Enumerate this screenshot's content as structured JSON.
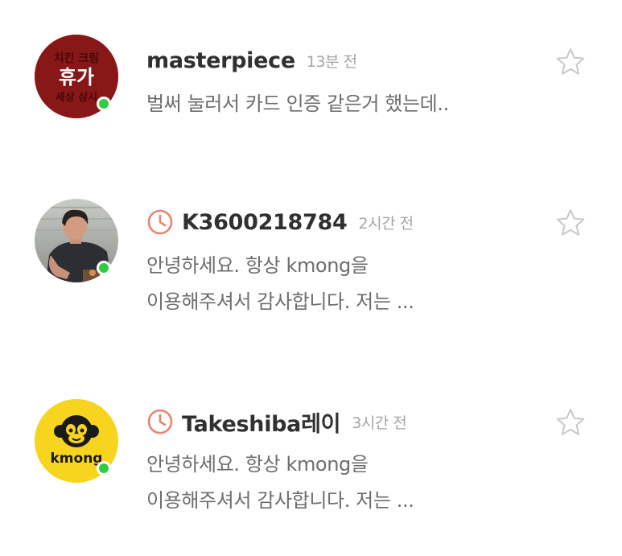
{
  "conversations": [
    {
      "avatar": {
        "kind": "image",
        "text_top": "치킨 크림",
        "text_main": "휴가",
        "text_bottom": "세상 삼시",
        "bg_color": "#8e1a1a"
      },
      "online": true,
      "pending": false,
      "name": "masterpiece",
      "time": "13분 전",
      "preview_lines": [
        "벌써 눌러서 카드 인증 같은거 했는데.."
      ],
      "starred": false
    },
    {
      "avatar": {
        "kind": "photo",
        "description_icon": "person-photo"
      },
      "online": true,
      "pending": true,
      "name": "K3600218784",
      "time": "2시간 전",
      "preview_lines": [
        "안녕하세요. 항상 kmong을",
        "이용해주셔서 감사합니다. 저는 ..."
      ],
      "starred": false
    },
    {
      "avatar": {
        "kind": "logo",
        "text_main": "kmong",
        "bg_color": "#f7d51f"
      },
      "online": true,
      "pending": true,
      "name": "Takeshiba레이",
      "time": "3시간 전",
      "preview_lines": [
        "안녕하세요. 항상 kmong을",
        "이용해주셔서 감사합니다. 저는 ..."
      ],
      "starred": false
    }
  ],
  "colors": {
    "name": "#303030",
    "time": "#a4a4a4",
    "preview": "#6d6d6d",
    "pending_clock": "#e8846f",
    "online": "#2ecc40",
    "star_outline": "#c8c8c8"
  },
  "icons": {
    "pending": "clock-icon",
    "favorite": "star-icon",
    "presence": "online-dot"
  }
}
